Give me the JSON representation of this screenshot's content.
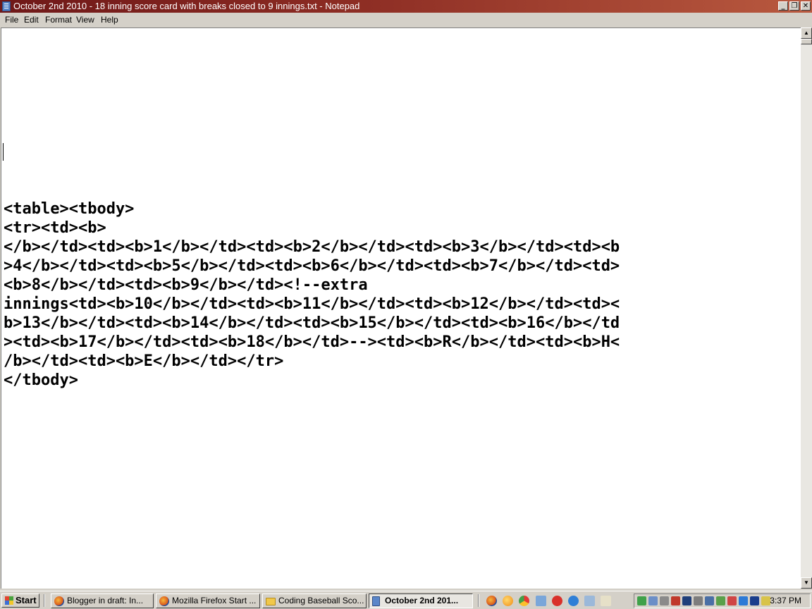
{
  "window": {
    "title": "October 2nd 2010 - 18 inning score card with breaks closed to 9 innings.txt - Notepad",
    "minimize": "_",
    "maximize": "❐",
    "close": "✕"
  },
  "menu": [
    {
      "label": "File"
    },
    {
      "label": "Edit"
    },
    {
      "label": "Format"
    },
    {
      "label": "View"
    },
    {
      "label": "Help"
    }
  ],
  "document": {
    "text": "<table><tbody>\n<tr><td><b>\n</b></td><td><b>1</b></td><td><b>2</b></td><td><b>3</b></td><td><b\n>4</b></td><td><b>5</b></td><td><b>6</b></td><td><b>7</b></td><td>\n<b>8</b></td><td><b>9</b></td><!--extra\ninnings<td><b>10</b></td><td><b>11</b></td><td><b>12</b></td><td><\nb>13</b></td><td><b>14</b></td><td><b>15</b></td><td><b>16</b></td\n><td><b>17</b></td><td><b>18</b></td>--><td><b>R</b></td><td><b>H<\n/b></td><td><b>E</b></td></tr>\n</tbody>"
  },
  "scrollbar": {
    "up": "▲",
    "down": "▼"
  },
  "taskbar": {
    "start_label": "Start",
    "tasks": [
      {
        "label": "Blogger in draft: In...",
        "icon": "firefox-icon",
        "color": "#e66a1c"
      },
      {
        "label": "Mozilla Firefox Start ...",
        "icon": "firefox-icon",
        "color": "#e66a1c"
      },
      {
        "label": "Coding Baseball Sco...",
        "icon": "folder-icon",
        "color": "#f1c84a"
      },
      {
        "label": "October 2nd 201...",
        "icon": "notepad-icon",
        "color": "#5a86c9",
        "active": true
      }
    ],
    "clock": "3:37 PM"
  }
}
